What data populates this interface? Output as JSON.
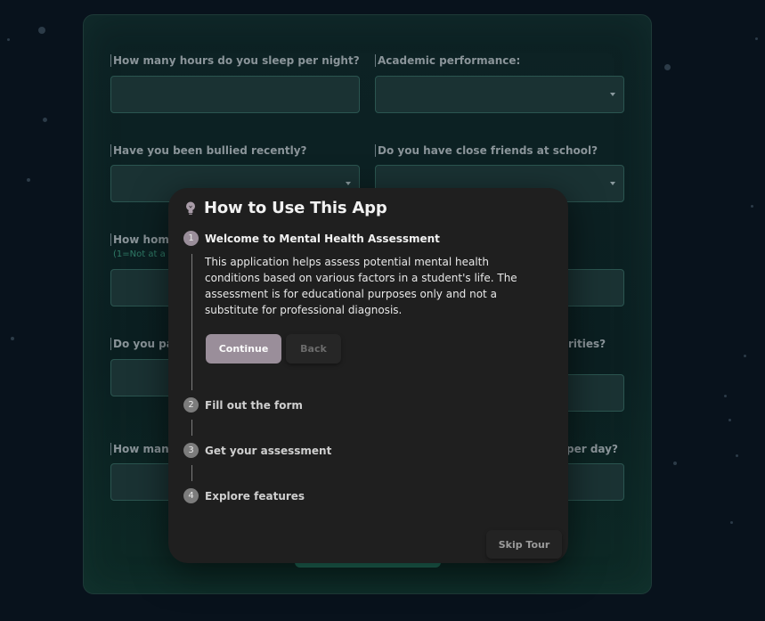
{
  "form": {
    "fields": [
      {
        "label": "How many hours do you sleep per night?",
        "type": "input",
        "value": ""
      },
      {
        "label": "Academic performance:",
        "type": "select",
        "value": ""
      },
      {
        "label": "Have you been bullied recently?",
        "type": "select",
        "value": ""
      },
      {
        "label": "Do you have close friends at school?",
        "type": "select",
        "value": ""
      },
      {
        "label": "How hom",
        "sub": "(1=Not at a",
        "type": "input",
        "value": ""
      },
      {
        "label": "",
        "type": "input",
        "value": ""
      },
      {
        "label": "Do you pa",
        "type": "input",
        "value": ""
      },
      {
        "label": "rities?",
        "type": "input",
        "value": ""
      },
      {
        "label": "How man",
        "type": "input",
        "value": ""
      },
      {
        "label": "per day?",
        "type": "input",
        "value": ""
      }
    ]
  },
  "tour": {
    "title": "How to Use This App",
    "icon": "lightbulb-icon",
    "steps": [
      {
        "number": "1",
        "title": "Welcome to Mental Health Assessment"
      },
      {
        "number": "2",
        "title": "Fill out the form"
      },
      {
        "number": "3",
        "title": "Get your assessment"
      },
      {
        "number": "4",
        "title": "Explore features"
      }
    ],
    "active_step_description": "This application helps assess potential mental health conditions based on various factors in a student's life. The assessment is for educational purposes only and not a substitute for professional diagnosis.",
    "continue_label": "Continue",
    "back_label": "Back",
    "skip_label": "Skip Tour"
  },
  "colors": {
    "background": "#08121c",
    "accent": "#9a8e9a",
    "modal": "#1f1f1f",
    "field_border": "#2b5550"
  }
}
